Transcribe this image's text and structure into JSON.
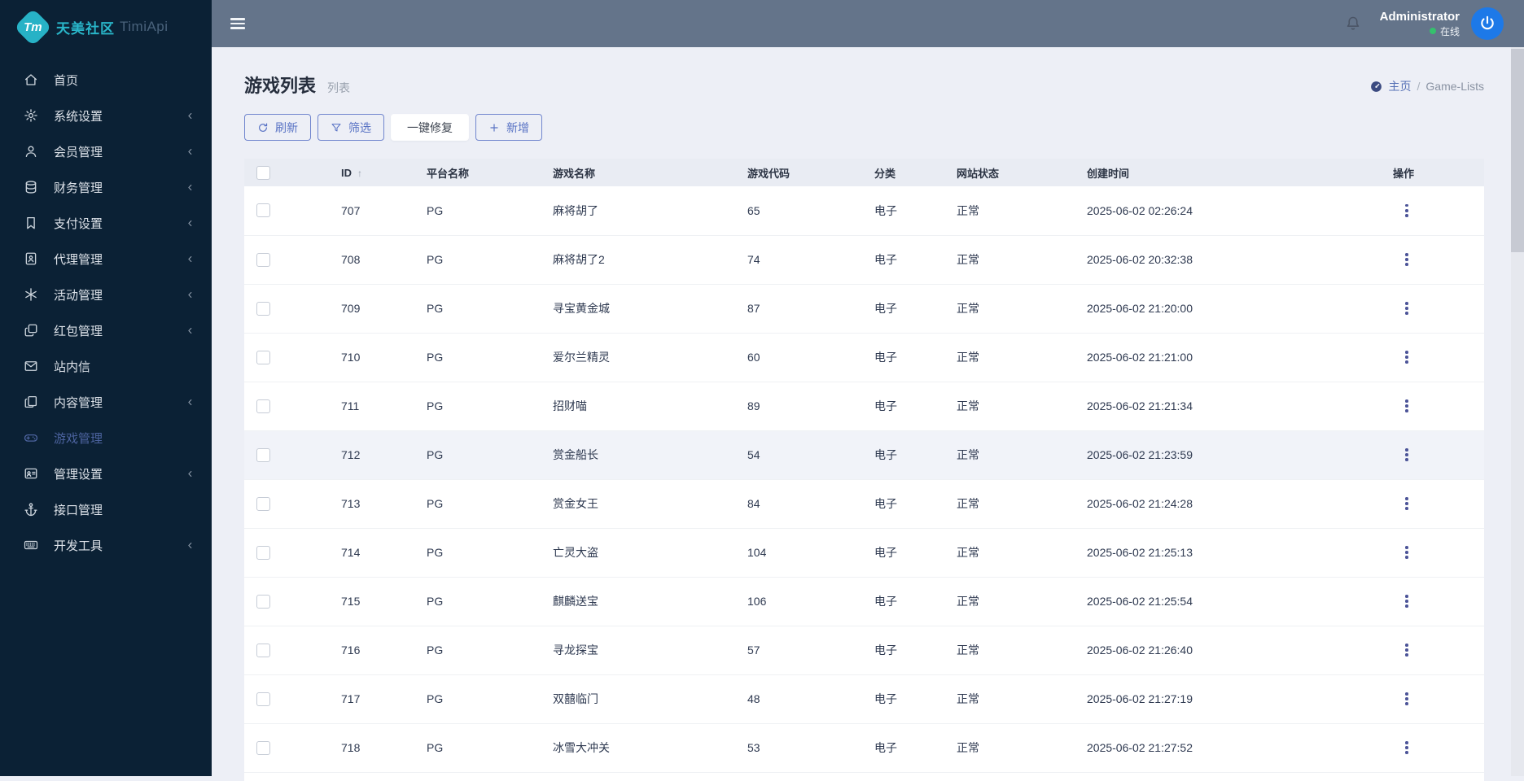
{
  "brand": {
    "logo_short": "Tm",
    "name_cn": "天美社区",
    "name_en": "TimiApi"
  },
  "sidebar": {
    "items": [
      {
        "label": "首页",
        "icon": "home-icon",
        "chevron": false,
        "active": false
      },
      {
        "label": "系统设置",
        "icon": "gear-icon",
        "chevron": true,
        "active": false
      },
      {
        "label": "会员管理",
        "icon": "user-icon",
        "chevron": true,
        "active": false
      },
      {
        "label": "财务管理",
        "icon": "database-icon",
        "chevron": true,
        "active": false
      },
      {
        "label": "支付设置",
        "icon": "bookmark-icon",
        "chevron": true,
        "active": false
      },
      {
        "label": "代理管理",
        "icon": "address-book-icon",
        "chevron": true,
        "active": false
      },
      {
        "label": "活动管理",
        "icon": "asterisk-icon",
        "chevron": true,
        "active": false
      },
      {
        "label": "红包管理",
        "icon": "clone-icon",
        "chevron": true,
        "active": false
      },
      {
        "label": "站内信",
        "icon": "envelope-icon",
        "chevron": false,
        "active": false
      },
      {
        "label": "内容管理",
        "icon": "copy-icon",
        "chevron": true,
        "active": false
      },
      {
        "label": "游戏管理",
        "icon": "gamepad-icon",
        "chevron": false,
        "active": true
      },
      {
        "label": "管理设置",
        "icon": "id-card-icon",
        "chevron": true,
        "active": false
      },
      {
        "label": "接口管理",
        "icon": "anchor-icon",
        "chevron": false,
        "active": false
      },
      {
        "label": "开发工具",
        "icon": "keyboard-icon",
        "chevron": true,
        "active": false
      }
    ]
  },
  "navbar": {
    "username": "Administrator",
    "status_label": "在线",
    "status_color": "#35c06d"
  },
  "page": {
    "title": "游戏列表",
    "subtitle": "列表",
    "breadcrumb": {
      "home": "主页",
      "separator": "/",
      "current": "Game-Lists"
    }
  },
  "toolbar": {
    "refresh_label": "刷新",
    "filter_label": "筛选",
    "repair_label": "一键修复",
    "add_label": "新增"
  },
  "table": {
    "columns": [
      "ID",
      "平台名称",
      "游戏名称",
      "游戏代码",
      "分类",
      "网站状态",
      "创建时间",
      "操作"
    ],
    "sorted_column": "ID",
    "sort_direction_glyph": "↑",
    "highlighted_row_id": "712",
    "rows": [
      {
        "id": "707",
        "platform": "PG",
        "name": "麻将胡了",
        "code": "65",
        "category": "电子",
        "status": "正常",
        "created": "2025-06-02 02:26:24"
      },
      {
        "id": "708",
        "platform": "PG",
        "name": "麻将胡了2",
        "code": "74",
        "category": "电子",
        "status": "正常",
        "created": "2025-06-02 20:32:38"
      },
      {
        "id": "709",
        "platform": "PG",
        "name": "寻宝黄金城",
        "code": "87",
        "category": "电子",
        "status": "正常",
        "created": "2025-06-02 21:20:00"
      },
      {
        "id": "710",
        "platform": "PG",
        "name": "爱尔兰精灵",
        "code": "60",
        "category": "电子",
        "status": "正常",
        "created": "2025-06-02 21:21:00"
      },
      {
        "id": "711",
        "platform": "PG",
        "name": "招财喵",
        "code": "89",
        "category": "电子",
        "status": "正常",
        "created": "2025-06-02 21:21:34"
      },
      {
        "id": "712",
        "platform": "PG",
        "name": "赏金船长",
        "code": "54",
        "category": "电子",
        "status": "正常",
        "created": "2025-06-02 21:23:59"
      },
      {
        "id": "713",
        "platform": "PG",
        "name": "赏金女王",
        "code": "84",
        "category": "电子",
        "status": "正常",
        "created": "2025-06-02 21:24:28"
      },
      {
        "id": "714",
        "platform": "PG",
        "name": "亡灵大盗",
        "code": "104",
        "category": "电子",
        "status": "正常",
        "created": "2025-06-02 21:25:13"
      },
      {
        "id": "715",
        "platform": "PG",
        "name": "麒麟送宝",
        "code": "106",
        "category": "电子",
        "status": "正常",
        "created": "2025-06-02 21:25:54"
      },
      {
        "id": "716",
        "platform": "PG",
        "name": "寻龙探宝",
        "code": "57",
        "category": "电子",
        "status": "正常",
        "created": "2025-06-02 21:26:40"
      },
      {
        "id": "717",
        "platform": "PG",
        "name": "双囍临门",
        "code": "48",
        "category": "电子",
        "status": "正常",
        "created": "2025-06-02 21:27:19"
      },
      {
        "id": "718",
        "platform": "PG",
        "name": "冰雪大冲关",
        "code": "53",
        "category": "电子",
        "status": "正常",
        "created": "2025-06-02 21:27:52"
      }
    ]
  },
  "colors": {
    "sidebar_bg": "#0b2135",
    "navbar_bg": "#64748a",
    "page_bg": "#edeff6",
    "accent_outline": "#5872c4",
    "brand_teal": "#29b6c9",
    "active_item": "#4c639f",
    "power_button": "#1d79e8"
  }
}
